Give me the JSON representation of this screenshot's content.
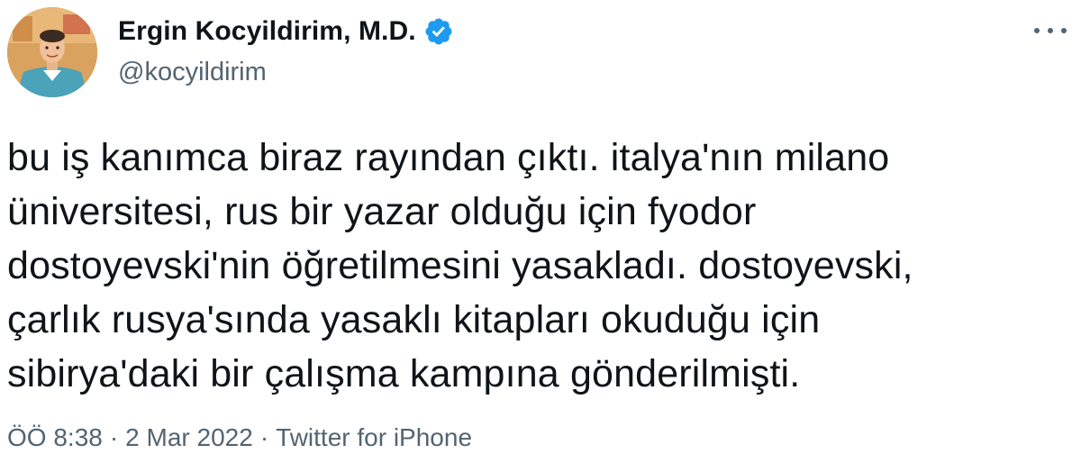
{
  "author": {
    "display_name": "Ergin Kocyildirim, M.D.",
    "handle": "@kocyildirim",
    "verified": true
  },
  "icons": {
    "verified": "verified-badge-icon",
    "more": "more-options-icon"
  },
  "tweet": {
    "text": "bu iş kanımca biraz rayından çıktı. italya'nın milano\nüniversitesi, rus bir yazar olduğu için fyodor\ndostoyevski'nin öğretilmesini yasakladı. dostoyevski,\nçarlık rusya'sında yasaklı kitapları okuduğu için\nsibirya'daki bir çalışma kampına gönderilmişti.",
    "time": "ÖÖ 8:38",
    "date": "2 Mar 2022",
    "source": "Twitter for iPhone",
    "separator": "·"
  },
  "colors": {
    "accent": "#1d9bf0",
    "text_primary": "#0f1419",
    "text_secondary": "#536471"
  }
}
